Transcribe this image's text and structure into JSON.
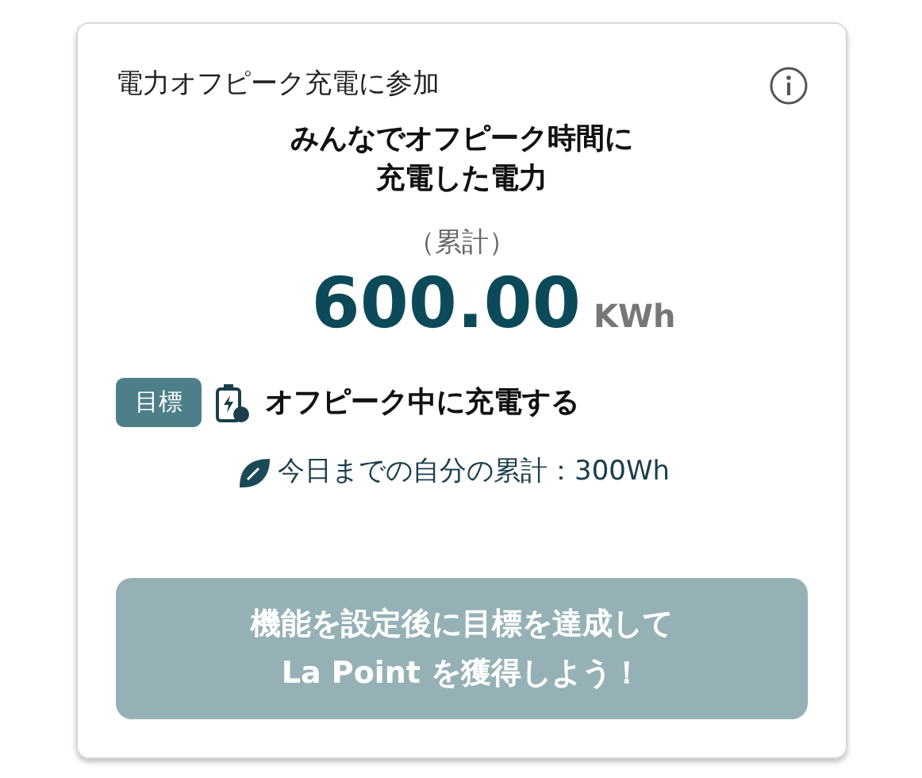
{
  "card": {
    "title": "電力オフピーク充電に参加",
    "headline": "みんなでオフピーク時間に充電した電力",
    "total_label": "（累計）",
    "total_value": "600.00",
    "total_unit": "KWh",
    "goal_badge": "目標",
    "goal_text": "オフピーク中に充電する",
    "personal_total": "今日までの自分の累計：300Wh",
    "action_button": {
      "label": "機能を設定後に目標を達成してLa Point を獲得しよう！",
      "disabled": true
    }
  }
}
